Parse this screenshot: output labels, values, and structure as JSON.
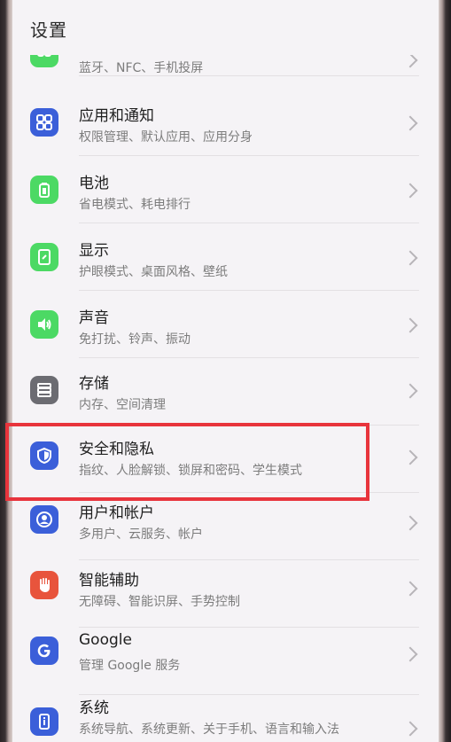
{
  "header": {
    "title": "设置"
  },
  "items": [
    {
      "title": "",
      "subtitle": "蓝牙、NFC、手机投屏",
      "icon": "link-icon",
      "color": "#4cd964"
    },
    {
      "title": "应用和通知",
      "subtitle": "权限管理、默认应用、应用分身",
      "icon": "apps-grid-icon",
      "color": "#3b5fd9"
    },
    {
      "title": "电池",
      "subtitle": "省电模式、耗电排行",
      "icon": "battery-icon",
      "color": "#4cd964"
    },
    {
      "title": "显示",
      "subtitle": "护眼模式、桌面风格、壁纸",
      "icon": "display-icon",
      "color": "#4cd964"
    },
    {
      "title": "声音",
      "subtitle": "免打扰、铃声、振动",
      "icon": "speaker-icon",
      "color": "#4cd964"
    },
    {
      "title": "存储",
      "subtitle": "内存、空间清理",
      "icon": "storage-icon",
      "color": "#6c6c72"
    },
    {
      "title": "安全和隐私",
      "subtitle": "指纹、人脸解锁、锁屏和密码、学生模式",
      "icon": "shield-icon",
      "color": "#3b5fd9"
    },
    {
      "title": "用户和帐户",
      "subtitle": "多用户、云服务、帐户",
      "icon": "user-icon",
      "color": "#3b5fd9"
    },
    {
      "title": "智能辅助",
      "subtitle": "无障碍、智能识屏、手势控制",
      "icon": "hand-icon",
      "color": "#e8543c"
    },
    {
      "title": "Google",
      "subtitle": "管理 Google 服务",
      "icon": "google-icon",
      "color": "#3b5fd9"
    },
    {
      "title": "系统",
      "subtitle": "系统导航、系统更新、关于手机、语言和输入法",
      "icon": "phone-info-icon",
      "color": "#3b5fd9"
    }
  ]
}
